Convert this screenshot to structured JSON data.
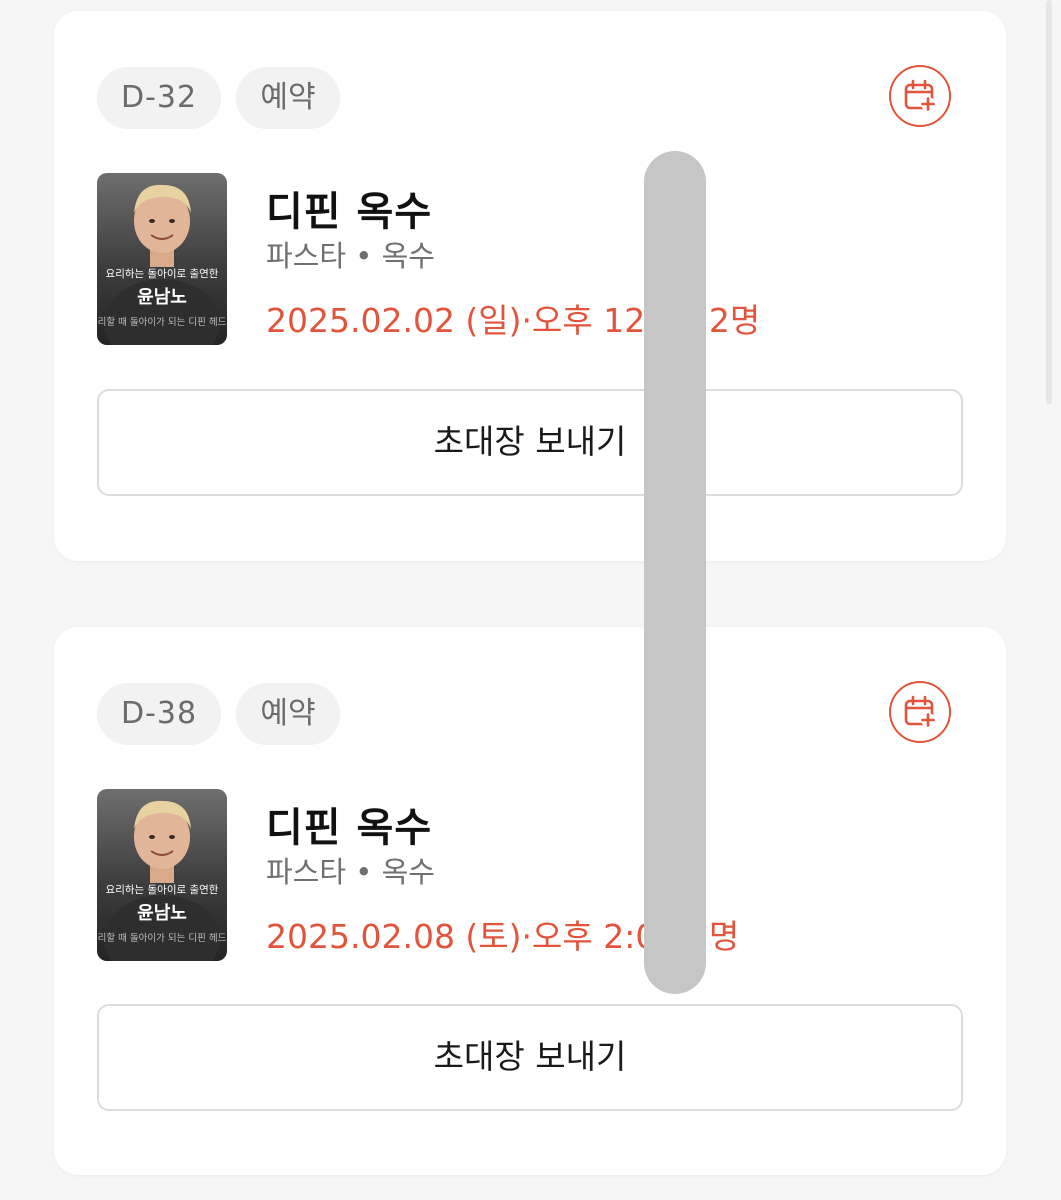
{
  "colors": {
    "accent": "#e2543b",
    "background": "#f6f6f6",
    "card": "#ffffff",
    "chip_bg": "#f2f2f2",
    "scrollbar": "#c6c6c6"
  },
  "reservations": [
    {
      "dday": "D-32",
      "status": "예약",
      "calendar_icon": "calendar-plus-icon",
      "thumbnail": {
        "caption_top": "요리하는 돌아이로 출연한",
        "name": "윤남노",
        "caption_bottom": "리할 때 돌아이가 되는 디핀 헤드"
      },
      "restaurant": "디핀 옥수",
      "category": "파스타",
      "location": "옥수",
      "schedule": "2025.02.02 (일)·오후 12:00·2명",
      "invite_label": "초대장 보내기"
    },
    {
      "dday": "D-38",
      "status": "예약",
      "calendar_icon": "calendar-plus-icon",
      "thumbnail": {
        "caption_top": "요리하는 돌아이로 출연한",
        "name": "윤남노",
        "caption_bottom": "리할 때 돌아이가 되는 디핀 헤드"
      },
      "restaurant": "디핀 옥수",
      "category": "파스타",
      "location": "옥수",
      "schedule": "2025.02.08 (토)·오후 2:00·2명",
      "invite_label": "초대장 보내기"
    }
  ]
}
